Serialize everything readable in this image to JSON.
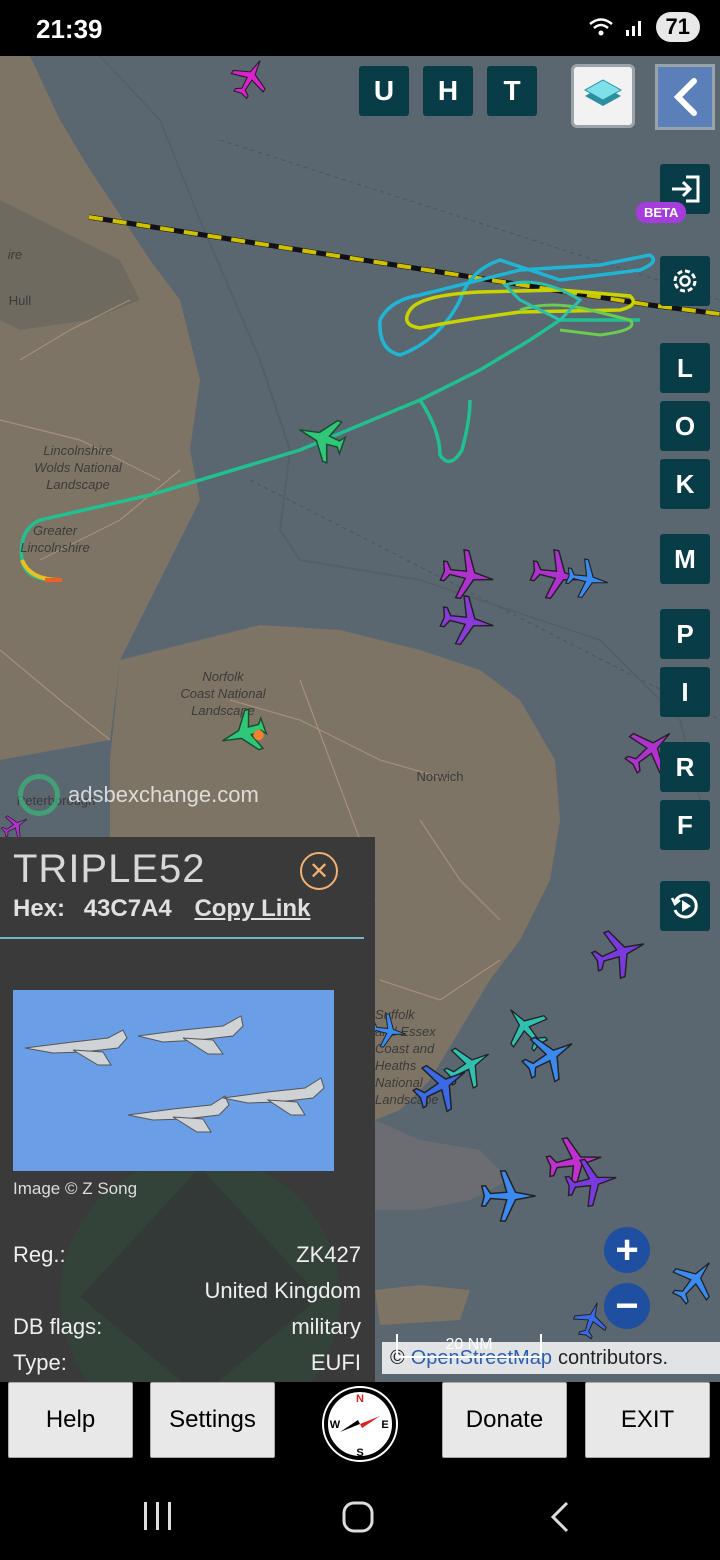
{
  "status": {
    "time": "21:39",
    "battery": "71"
  },
  "toolbar": {
    "u": "U",
    "h": "H",
    "t": "T"
  },
  "beta_badge": "BETA",
  "right_buttons": [
    "L",
    "O",
    "K",
    "M",
    "P",
    "I",
    "R",
    "F"
  ],
  "map_labels": {
    "hull": "Hull",
    "wolds": "Lincolnshire\nWolds National\nLandscape",
    "greater_lincs": "Greater\nLincolnshire",
    "norfolk": "Norfolk\nCoast National\nLandscape",
    "norwich": "Norwich",
    "suffolk": "Suffolk\nand Essex\nCoast and\nHeaths\nNational\nLandscape",
    "ire": "ire",
    "peterborough": "Peterborough"
  },
  "watermark": "adsbexchange.com",
  "scale": "20 NM",
  "attribution": {
    "prefix": "©",
    "link": "OpenStreetMap",
    "suffix": "contributors."
  },
  "aircraft_panel": {
    "callsign": "TRIPLE52",
    "hex_label": "Hex:",
    "hex": "43C7A4",
    "copy_link": "Copy Link",
    "image_credit": "Image © Z Song",
    "reg_label": "Reg.:",
    "reg": "ZK427",
    "country": "United Kingdom",
    "flags_label": "DB flags:",
    "flags": "military",
    "type_label": "Type:",
    "type": "EUFI"
  },
  "bottom_buttons": {
    "help": "Help",
    "settings": "Settings",
    "donate": "Donate",
    "exit": "EXIT"
  },
  "compass": {
    "n": "N",
    "s": "S",
    "e": "E",
    "w": "W"
  },
  "colors": {
    "button_bg": "#083c46",
    "sea": "#5a6670",
    "track_green": "#22c39a",
    "track_yellow": "#c8d400",
    "track_cyan": "#1fb6d6"
  }
}
